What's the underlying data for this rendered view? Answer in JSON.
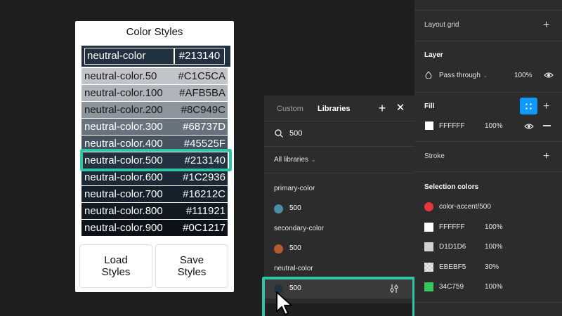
{
  "plugin": {
    "title": "Color Styles",
    "header": {
      "name": "neutral-color",
      "hex": "#213140"
    },
    "swatches": [
      {
        "name": "neutral-color.50",
        "hex": "#C1C5CA",
        "bg": "#C1C5CA",
        "text": "#1a1a1a"
      },
      {
        "name": "neutral-color.100",
        "hex": "#AFB5BA",
        "bg": "#AFB5BA",
        "text": "#1a1a1a"
      },
      {
        "name": "neutral-color.200",
        "hex": "#8C949C",
        "bg": "#8C949C",
        "text": "#1a1a1a"
      },
      {
        "name": "neutral-color.300",
        "hex": "#68737D",
        "bg": "#68737D",
        "text": "#ffffff"
      },
      {
        "name": "neutral-color.400",
        "hex": "#45525F",
        "bg": "#45525F",
        "text": "#ffffff"
      },
      {
        "name": "neutral-color.500",
        "hex": "#213140",
        "bg": "#213140",
        "text": "#ffffff"
      },
      {
        "name": "neutral-color.600",
        "hex": "#1C2936",
        "bg": "#1C2936",
        "text": "#ffffff"
      },
      {
        "name": "neutral-color.700",
        "hex": "#16212C",
        "bg": "#16212C",
        "text": "#ffffff"
      },
      {
        "name": "neutral-color.800",
        "hex": "#111921",
        "bg": "#111921",
        "text": "#ffffff"
      },
      {
        "name": "neutral-color.900",
        "hex": "#0C1217",
        "bg": "#0C1217",
        "text": "#ffffff"
      }
    ],
    "load_label": "Load\nStyles",
    "save_label": "Save\nStyles"
  },
  "picker": {
    "tab_custom": "Custom",
    "tab_libraries": "Libraries",
    "add_icon": "plus-icon",
    "close_icon": "close-icon",
    "search_value": "500",
    "library_select": "All libraries",
    "groups": [
      {
        "label": "primary-color",
        "item": "500",
        "color": "#4a8ea3"
      },
      {
        "label": "secondary-color",
        "item": "500",
        "color": "#b45a2e"
      },
      {
        "label": "neutral-color",
        "item": "500",
        "color": "#213140"
      }
    ]
  },
  "panel": {
    "layout_grid": "Layout grid",
    "layer": "Layer",
    "blend_mode": "Pass through",
    "layer_opacity": "100%",
    "fill": "Fill",
    "fill_hex": "FFFFFF",
    "fill_opacity": "100%",
    "stroke": "Stroke",
    "selection_colors": "Selection colors",
    "colors": [
      {
        "hex": "color-accent/500",
        "opacity": "",
        "swatch": "#e8363f",
        "round": true
      },
      {
        "hex": "FFFFFF",
        "opacity": "100%",
        "swatch": "#ffffff",
        "round": false
      },
      {
        "hex": "D1D1D6",
        "opacity": "100%",
        "swatch": "#d1d1d6",
        "round": false
      },
      {
        "hex": "EBEBF5",
        "opacity": "30%",
        "swatch": "checker",
        "round": false
      },
      {
        "hex": "34C759",
        "opacity": "100%",
        "swatch": "#34c759",
        "round": false
      }
    ]
  },
  "colors": {
    "accent_highlight": "#2fc4a3",
    "figma_blue": "#0d99ff"
  }
}
